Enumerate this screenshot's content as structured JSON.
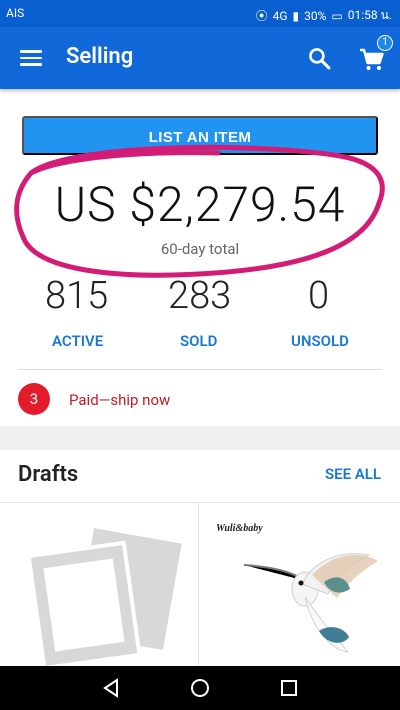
{
  "status_bar": {
    "carrier": "AIS",
    "network": "4G",
    "battery": "30%",
    "time": "01:58 น."
  },
  "app_bar": {
    "title": "Selling",
    "cart_badge": "1"
  },
  "primary_action": {
    "label": "LIST AN ITEM"
  },
  "summary": {
    "total": "US $2,279.54",
    "period": "60-day total"
  },
  "stats": [
    {
      "value": "815",
      "label": "ACTIVE"
    },
    {
      "value": "283",
      "label": "SOLD"
    },
    {
      "value": "0",
      "label": "UNSOLD"
    }
  ],
  "shipping": {
    "count": "3",
    "label": "Paid—ship now"
  },
  "drafts": {
    "title": "Drafts",
    "see_all": "SEE ALL",
    "items": [
      {
        "brand": "Wuli&baby"
      }
    ]
  },
  "colors": {
    "brand": "#1168d9",
    "accent": "#2193f0",
    "alert": "#e31c2c",
    "annotation": "#d21c76"
  }
}
